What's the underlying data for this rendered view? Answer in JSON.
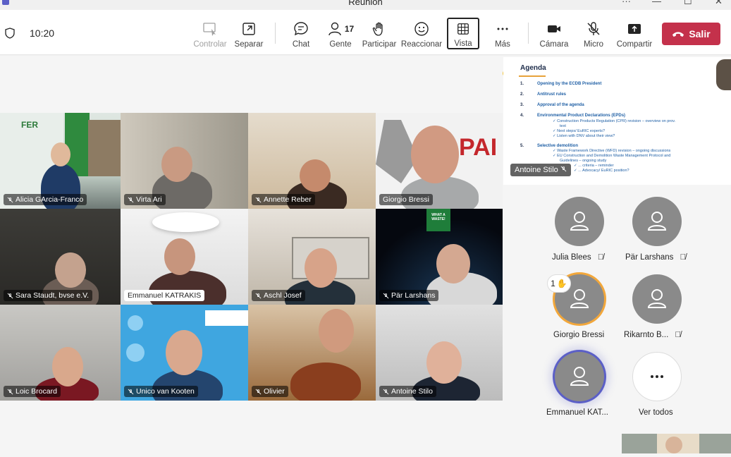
{
  "window": {
    "title": "Reunión",
    "more": "···",
    "minimize": "—",
    "maximize": "☐",
    "close": "✕"
  },
  "toolbar": {
    "time": "10:20",
    "buttons": [
      {
        "id": "controlar",
        "label": "Controlar",
        "icon": "control-icon",
        "enabled": false
      },
      {
        "id": "separar",
        "label": "Separar",
        "icon": "popout-icon",
        "enabled": true
      },
      {
        "id": "chat",
        "label": "Chat",
        "icon": "chat-icon",
        "enabled": true
      },
      {
        "id": "gente",
        "label": "Gente",
        "icon": "people-icon",
        "enabled": true,
        "count": "17"
      },
      {
        "id": "participar",
        "label": "Participar",
        "icon": "raise-hand-icon",
        "enabled": true
      },
      {
        "id": "reaccionar",
        "label": "Reaccionar",
        "icon": "emoji-icon",
        "enabled": true
      },
      {
        "id": "vista",
        "label": "Vista",
        "icon": "grid-icon",
        "enabled": true,
        "selected": true
      },
      {
        "id": "mas",
        "label": "Más",
        "icon": "more-icon",
        "enabled": true
      },
      {
        "id": "camara",
        "label": "Cámara",
        "icon": "camera-icon",
        "enabled": true
      },
      {
        "id": "micro",
        "label": "Micro",
        "icon": "mic-off-icon",
        "enabled": true
      },
      {
        "id": "compartir",
        "label": "Compartir",
        "icon": "share-icon",
        "enabled": true
      }
    ],
    "leave_label": "Salir"
  },
  "video_tiles": [
    {
      "name": "Alicia GArcia-Franco"
    },
    {
      "name": "Virta Ari"
    },
    {
      "name": "Annette Reber"
    },
    {
      "name": "Giorgio Bressi"
    },
    {
      "name": "Sara Staudt, bvse e.V."
    },
    {
      "name": "Emmanuel KATRAKIS"
    },
    {
      "name": "Aschl Josef"
    },
    {
      "name": "Pär Larshans"
    },
    {
      "name": "Loic Brocard"
    },
    {
      "name": "Unico van Kooten"
    },
    {
      "name": "Olivier"
    },
    {
      "name": "Antoine Stilo"
    }
  ],
  "shared_content": {
    "presenter": "Antoine Stilo",
    "title": "Agenda",
    "items": [
      {
        "n": "1.",
        "text": "Opening by the ECDB President"
      },
      {
        "n": "2.",
        "text": "Antitrust rules"
      },
      {
        "n": "3.",
        "text": "Approval of the agenda"
      },
      {
        "n": "4.",
        "text": "Environmental Product Declarations (EPDs)"
      },
      {
        "n": "5.",
        "text": "Selective demolition"
      }
    ],
    "sub4": [
      "✓ Construction Products Regulation (CPR) revision – overview on prov.",
      "text",
      "✓ Next steps/ EuRIC experts?",
      "✓ Listen with DNV about their view?"
    ],
    "sub5": [
      "✓ Waste Framework Directive (WFD) revision – ongoing discussions",
      "✓ EU Construction and Demolition Waste Management Protocol and",
      "Guidelines – ongoing study",
      "✓ ... criteria – reminder",
      "✓ ... Advocacy/ EuRIC position?"
    ]
  },
  "roster": [
    {
      "name": "Julia Blees",
      "muted": true
    },
    {
      "name": "Pär Larshans",
      "muted": true
    },
    {
      "name": "Giorgio Bressi",
      "muted": false,
      "hand": "1"
    },
    {
      "name": "Rikarnto B...",
      "muted": true
    },
    {
      "name": "Emmanuel KAT...",
      "muted": false
    },
    {
      "name": "Ver todos",
      "muted": false
    }
  ],
  "colors": {
    "leave": "#c4314b",
    "accent": "#5b5fc7",
    "hand_ring": "#f2a73b"
  }
}
